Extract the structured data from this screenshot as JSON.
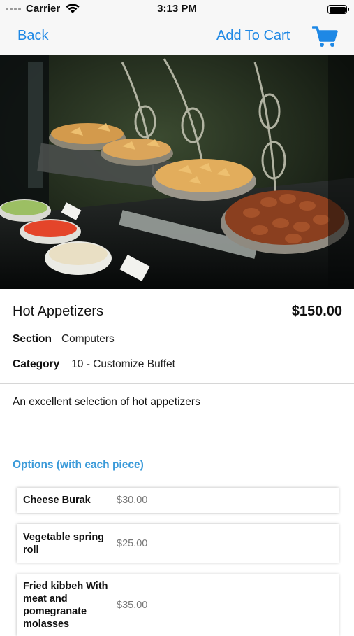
{
  "status_bar": {
    "carrier": "Carrier",
    "time": "3:13 PM"
  },
  "nav": {
    "back_label": "Back",
    "add_to_cart_label": "Add To Cart",
    "cart_icon": "cart-icon"
  },
  "product": {
    "title": "Hot Appetizers",
    "price": "$150.00",
    "section_label": "Section",
    "section_value": "Computers",
    "category_label": "Category",
    "category_value": "10 - Customize Buffet",
    "description": "An excellent selection of hot appetizers"
  },
  "options": {
    "title": "Options (with each piece)",
    "items": [
      {
        "name": "Cheese Burak",
        "price": "$30.00"
      },
      {
        "name": "Vegetable spring roll",
        "price": "$25.00"
      },
      {
        "name": "Fried kibbeh With meat and pomegranate molasses",
        "price": "$35.00"
      }
    ]
  },
  "colors": {
    "accent": "#1e88e5",
    "section_heading": "#3a9ad9",
    "nav_background": "#f7f7f7"
  }
}
